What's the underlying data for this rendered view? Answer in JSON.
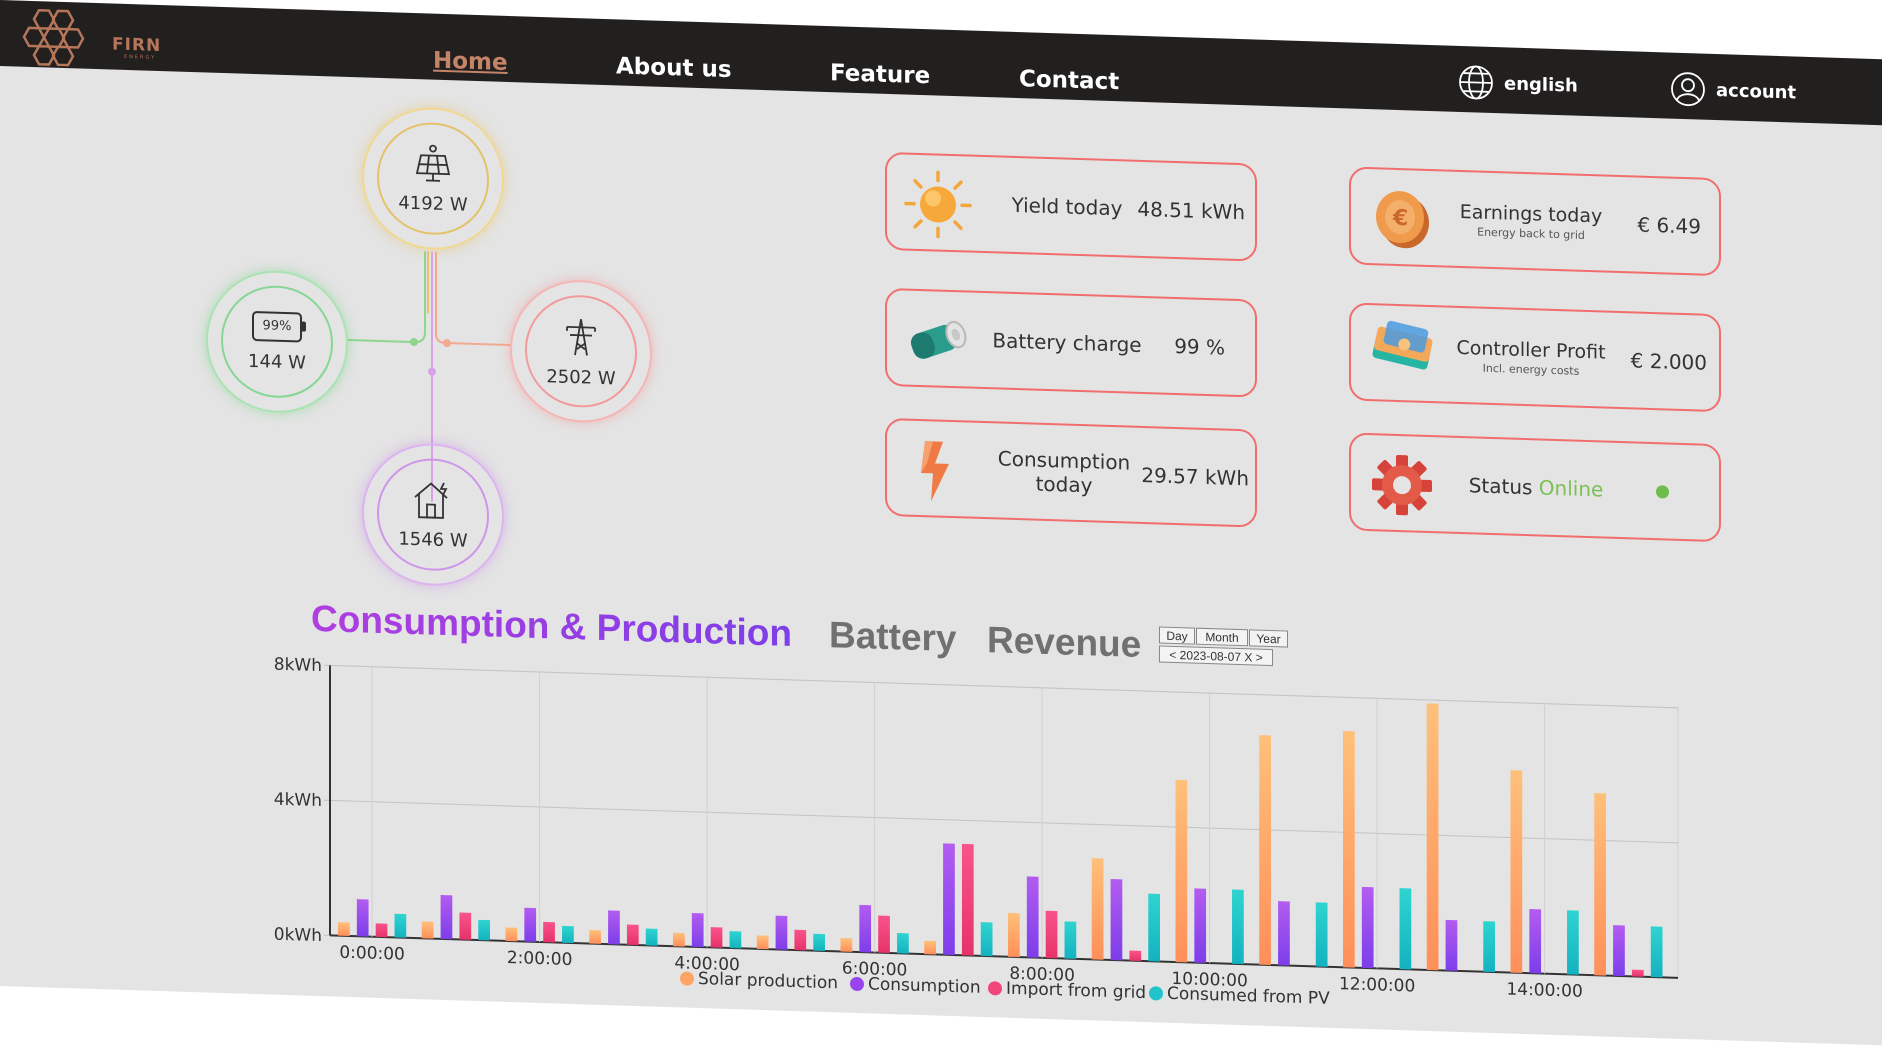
{
  "brand": {
    "name": "FIRN",
    "tagline": "ENERGY"
  },
  "nav": {
    "links": [
      {
        "label": "Home",
        "active": true
      },
      {
        "label": "About us",
        "active": false
      },
      {
        "label": "Feature",
        "active": false
      },
      {
        "label": "Contact",
        "active": false
      }
    ],
    "language": "english",
    "account": "account"
  },
  "energy_flow": {
    "solar": {
      "value": "4192 W",
      "icon": "solar-panel-icon"
    },
    "battery": {
      "value": "144 W",
      "level": "99%",
      "icon": "battery-icon"
    },
    "grid": {
      "value": "2502 W",
      "icon": "power-tower-icon"
    },
    "home": {
      "value": "1546 W",
      "icon": "house-icon"
    }
  },
  "cards": {
    "yield": {
      "label": "Yield today",
      "value": "48.51 kWh",
      "icon": "sun-icon"
    },
    "battery": {
      "label": "Battery charge",
      "value": "99 %",
      "icon": "battery-3d-icon"
    },
    "consumption": {
      "label": "Consumption today",
      "value": "29.57 kWh",
      "icon": "lightning-icon"
    },
    "earnings": {
      "label": "Earnings today",
      "sublabel": "Energy back to grid",
      "value": "€ 6.49",
      "icon": "coin-icon"
    },
    "profit": {
      "label": "Controller Profit",
      "sublabel": "Incl. energy costs",
      "value": "€ 2.000",
      "icon": "banknote-icon"
    },
    "status": {
      "label": "Status",
      "status_text": "Online",
      "status_color": "#7cc057",
      "icon": "gear-icon"
    }
  },
  "tabs": [
    {
      "label": "Consumption & Production",
      "active": true
    },
    {
      "label": "Battery",
      "active": false
    },
    {
      "label": "Revenue",
      "active": false
    }
  ],
  "period_controls": {
    "buttons": [
      "Day",
      "Month",
      "Year"
    ],
    "date_label": "< 2023-08-07 X >"
  },
  "chart_data": {
    "type": "bar",
    "ylabel_ticks": [
      "0kWh",
      "4kWh",
      "8kWh"
    ],
    "ylim": [
      0,
      8
    ],
    "x_tick_labels": [
      "0:00:00",
      "2:00:00",
      "4:00:00",
      "6:00:00",
      "8:00:00",
      "10:00:00",
      "12:00:00",
      "14:00:00"
    ],
    "categories": [
      "0:00",
      "1:00",
      "2:00",
      "3:00",
      "4:00",
      "5:00",
      "6:00",
      "7:00",
      "8:00",
      "9:00",
      "10:00",
      "11:00",
      "12:00",
      "13:00",
      "14:00",
      "15:00"
    ],
    "series": [
      {
        "name": "Solar production",
        "color": "#ffa366",
        "values": [
          0.4,
          0.5,
          0.4,
          0.4,
          0.4,
          0.4,
          0.4,
          0.4,
          1.3,
          3.0,
          5.4,
          6.8,
          7.0,
          7.9,
          6.0,
          5.4
        ]
      },
      {
        "name": "Consumption",
        "color": "#9945ef",
        "values": [
          1.1,
          1.3,
          1.0,
          1.0,
          1.0,
          1.0,
          1.4,
          3.3,
          2.4,
          2.4,
          2.2,
          1.9,
          2.4,
          1.5,
          1.9,
          1.5
        ]
      },
      {
        "name": "Import from grid",
        "color": "#f2457b",
        "values": [
          0.4,
          0.8,
          0.6,
          0.6,
          0.6,
          0.6,
          1.1,
          3.3,
          1.4,
          0.3,
          0.0,
          0.0,
          0.0,
          0.0,
          0.0,
          0.2
        ]
      },
      {
        "name": "Consumed from PV",
        "color": "#20c4ca",
        "values": [
          0.7,
          0.6,
          0.5,
          0.5,
          0.5,
          0.5,
          0.6,
          1.0,
          1.1,
          2.0,
          2.2,
          1.9,
          2.4,
          1.5,
          1.9,
          1.5
        ]
      }
    ],
    "grid": true,
    "legend_position": "bottom"
  }
}
